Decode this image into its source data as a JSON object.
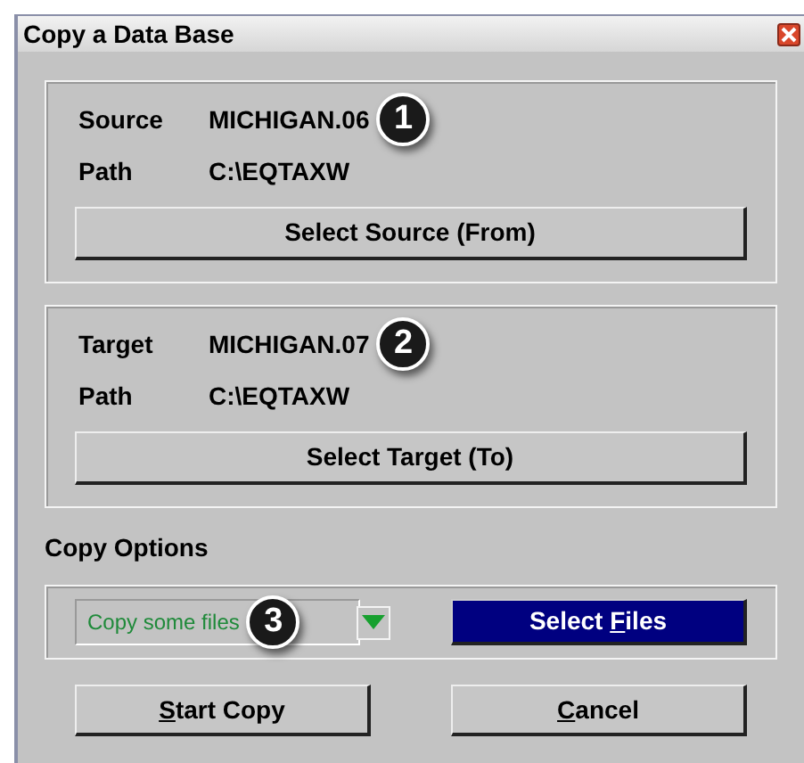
{
  "window": {
    "title": "Copy a Data Base"
  },
  "source": {
    "name_label": "Source",
    "name": "MICHIGAN.06",
    "badge": "1",
    "path_label": "Path",
    "path": "C:\\EQTAXW",
    "button": "Select Source (From)"
  },
  "target": {
    "name_label": "Target",
    "name": "MICHIGAN.07",
    "badge": "2",
    "path_label": "Path",
    "path": "C:\\EQTAXW",
    "button": "Select Target (To)"
  },
  "copy_options": {
    "label": "Copy Options",
    "dropdown": {
      "value": "Copy some files"
    },
    "badge": "3",
    "select_button": {
      "pre": "Select ",
      "key": "F",
      "post": "iles"
    }
  },
  "buttons": [
    {
      "key": "S",
      "post": "tart Copy"
    },
    {
      "key": "C",
      "post": "ancel"
    }
  ]
}
